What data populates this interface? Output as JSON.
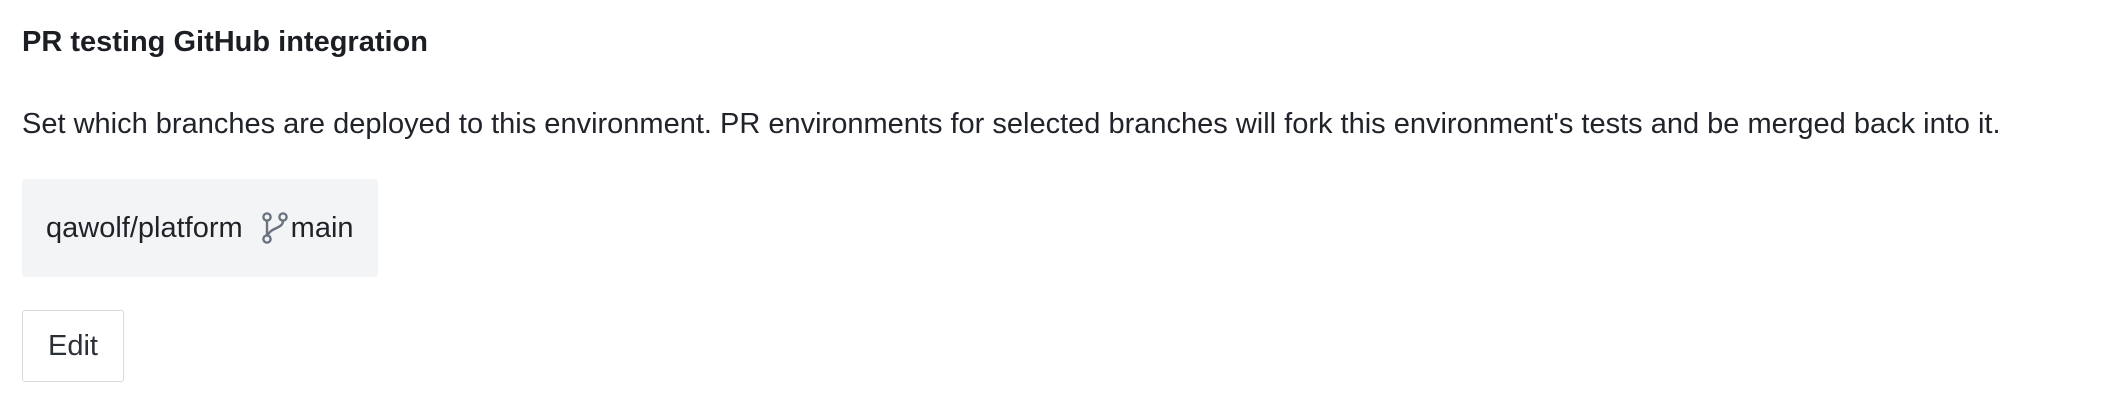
{
  "section": {
    "title": "PR testing GitHub integration",
    "description": "Set which branches are deployed to this environment. PR environments for selected branches will fork this environment's tests and be merged back into it."
  },
  "repo": {
    "name": "qawolf/platform",
    "branch": "main",
    "branch_icon": "git-branch-icon"
  },
  "actions": {
    "edit_label": "Edit"
  },
  "colors": {
    "chip_background": "#f3f4f6",
    "icon": "#6b7280",
    "button_border": "#d7dbe0"
  }
}
